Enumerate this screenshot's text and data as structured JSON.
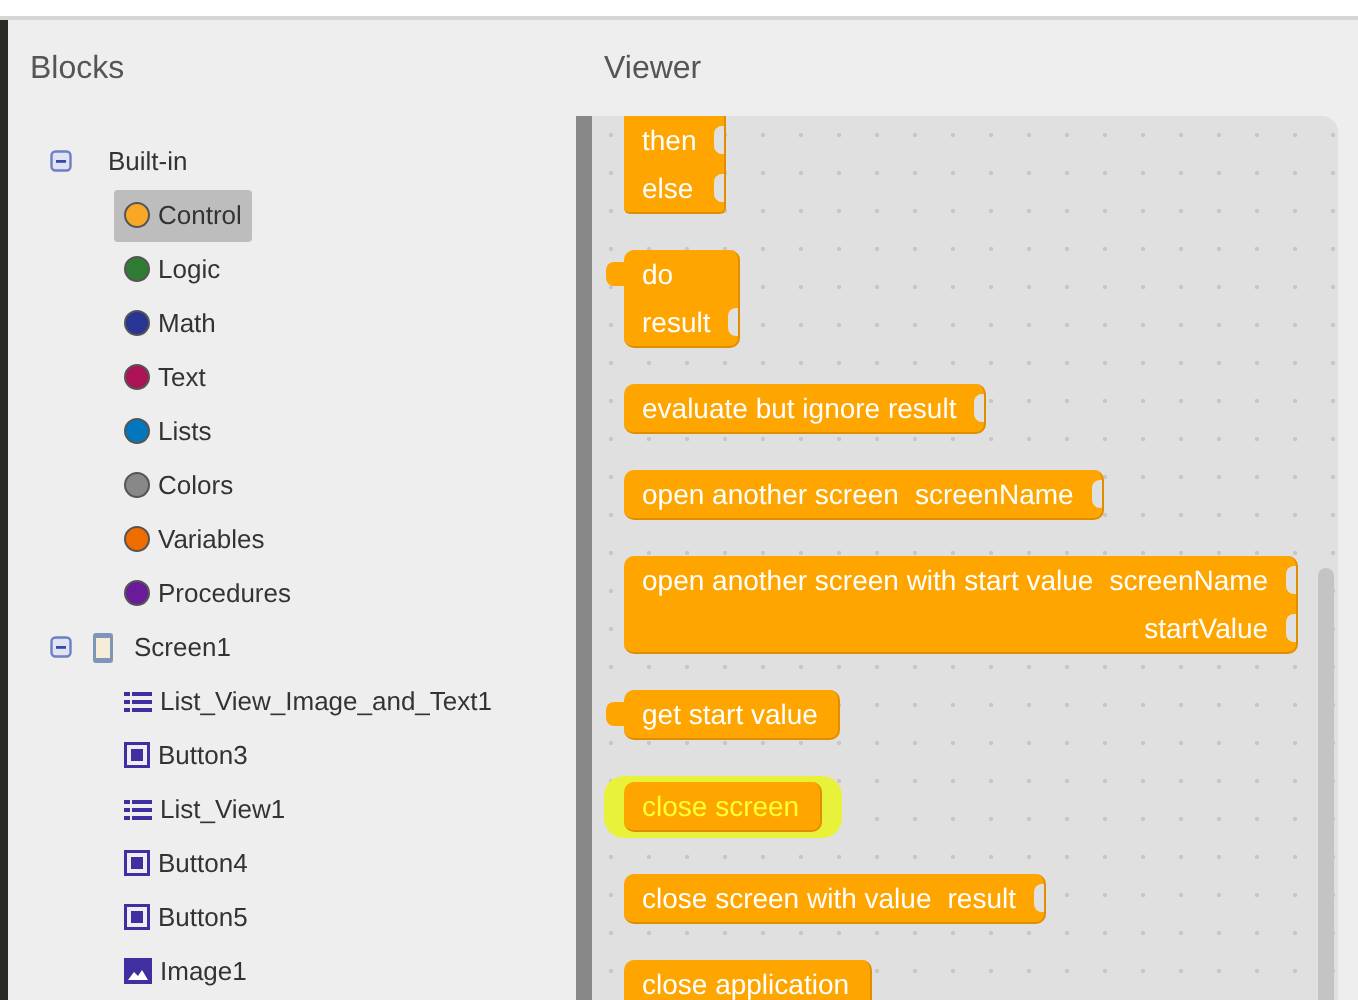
{
  "blocks_panel": {
    "title": "Blocks",
    "tree": [
      {
        "label": "Built-in",
        "kind": "group",
        "expanded": true,
        "children": [
          {
            "label": "Control",
            "color": "#f9a825",
            "selected": true
          },
          {
            "label": "Logic",
            "color": "#2e7d32",
            "selected": false
          },
          {
            "label": "Math",
            "color": "#283593",
            "selected": false
          },
          {
            "label": "Text",
            "color": "#ad1457",
            "selected": false
          },
          {
            "label": "Lists",
            "color": "#0277bd",
            "selected": false
          },
          {
            "label": "Colors",
            "color": "#888888",
            "selected": false
          },
          {
            "label": "Variables",
            "color": "#ef6c00",
            "selected": false
          },
          {
            "label": "Procedures",
            "color": "#6a1b9a",
            "selected": false
          }
        ]
      },
      {
        "label": "Screen1",
        "kind": "screen",
        "expanded": true,
        "children": [
          {
            "label": "List_View_Image_and_Text1",
            "kind": "list",
            "selected": false
          },
          {
            "label": "Button3",
            "kind": "button",
            "selected": false
          },
          {
            "label": "List_View1",
            "kind": "list",
            "selected": false
          },
          {
            "label": "Button4",
            "kind": "button",
            "selected": false
          },
          {
            "label": "Button5",
            "kind": "button",
            "selected": false
          },
          {
            "label": "Image1",
            "kind": "image",
            "selected": false
          }
        ]
      }
    ]
  },
  "viewer": {
    "title": "Viewer",
    "blocks": [
      {
        "kind": "fragment",
        "highlighted": false,
        "rows": [
          {
            "text": "then",
            "socket": true
          },
          {
            "text": "else",
            "socket": true
          }
        ]
      },
      {
        "kind": "value",
        "highlighted": false,
        "rows": [
          {
            "text": "do",
            "socket": false
          },
          {
            "text": "result",
            "socket": true
          }
        ]
      },
      {
        "kind": "statement",
        "highlighted": false,
        "rows": [
          {
            "text": "evaluate but ignore result",
            "socket": true
          }
        ]
      },
      {
        "kind": "statement",
        "highlighted": false,
        "rows": [
          {
            "text": "open another screen",
            "input": "screenName",
            "socket": true
          }
        ]
      },
      {
        "kind": "statement",
        "highlighted": false,
        "rows": [
          {
            "text": "open another screen with start value",
            "input": "screenName",
            "socket": true
          },
          {
            "input": "startValue",
            "socket": true
          }
        ]
      },
      {
        "kind": "value",
        "highlighted": false,
        "rows": [
          {
            "text": "get start value",
            "socket": false
          }
        ]
      },
      {
        "kind": "statement",
        "highlighted": true,
        "rows": [
          {
            "text": "close screen",
            "socket": false
          }
        ]
      },
      {
        "kind": "statement",
        "highlighted": false,
        "rows": [
          {
            "text": "close screen with value",
            "input": "result",
            "socket": true
          }
        ]
      },
      {
        "kind": "statement",
        "highlighted": false,
        "rows": [
          {
            "text": "close application",
            "socket": false
          }
        ]
      }
    ]
  }
}
